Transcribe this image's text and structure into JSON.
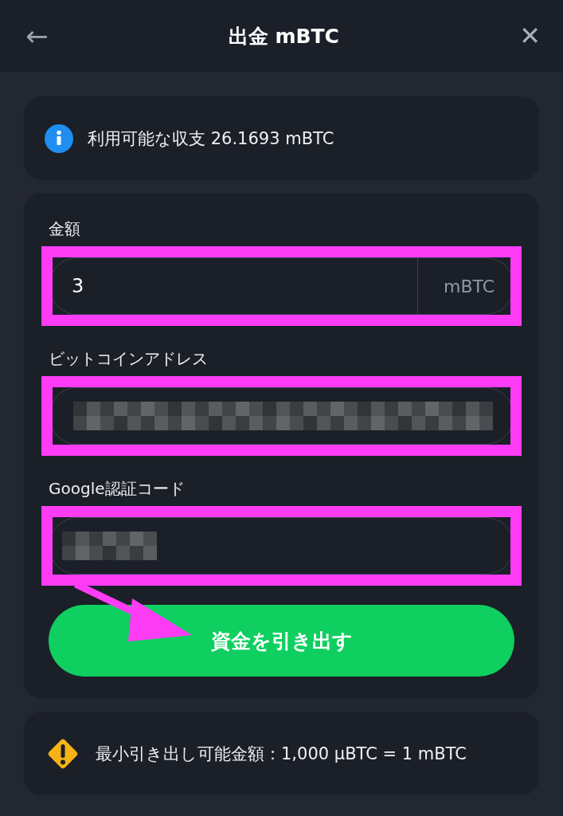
{
  "header": {
    "back": "←",
    "title": "出金 mBTC",
    "close": "✕"
  },
  "balance_notice": {
    "text": "利用可能な収支 26.1693 mBTC"
  },
  "form": {
    "fields": [
      {
        "kind": "amount",
        "label": "金額",
        "value": "3",
        "suffix": "mBTC",
        "highlighted": true
      },
      {
        "kind": "address",
        "label": "ビットコインアドレス",
        "redacted": true,
        "highlighted": true
      },
      {
        "kind": "code",
        "label": "Google認証コード",
        "redacted": true,
        "highlighted": true
      }
    ],
    "annotation_arrow": true,
    "submit": "資金を引き出す"
  },
  "minimum_notice": {
    "text": "最小引き出し可能金額：1,000 µBTC = 1 mBTC"
  }
}
